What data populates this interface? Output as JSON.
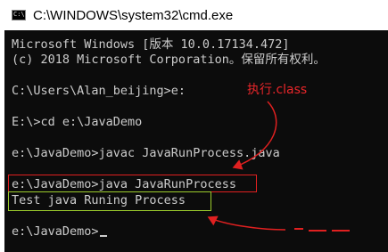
{
  "window": {
    "title": "C:\\WINDOWS\\system32\\cmd.exe",
    "icon": "cmd-icon",
    "icon_text": "C:\\"
  },
  "console": {
    "lines": [
      "Microsoft Windows [版本 10.0.17134.472]",
      "(c) 2018 Microsoft Corporation。保留所有权利。",
      "C:\\Users\\Alan_beijing>e:",
      "E:\\>cd e:\\JavaDemo",
      "e:\\JavaDemo>javac JavaRunProcess.java",
      "e:\\JavaDemo>java JavaRunProcess",
      "Test java Runing Process",
      "e:\\JavaDemo>"
    ]
  },
  "annotation": {
    "text": "执行.class",
    "color": "#e8262a"
  },
  "colors": {
    "console_bg": "#0c0c0c",
    "console_text": "#cccccc",
    "highlight_red": "#e02020",
    "highlight_green": "#9ccc2c"
  }
}
